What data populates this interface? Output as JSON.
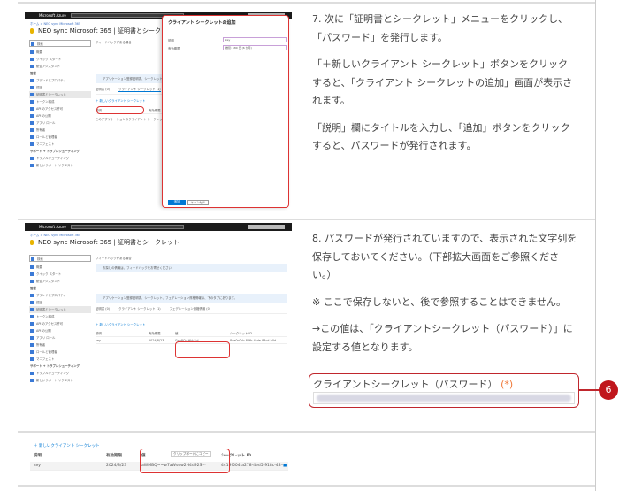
{
  "step7": {
    "paragraphs": [
      "7. 次に「証明書とシークレット」メニューをクリックし、「パスワード」を発行します。",
      "「＋新しいクライアント シークレット」ボタンをクリックすると、「クライアント シークレットの追加」画面が表示されます。",
      "「説明」欄にタイトルを入力し、「追加」ボタンをクリックすると、パスワードが発行されます。"
    ]
  },
  "step8": {
    "paragraphs": [
      "8. パスワードが発行されていますので、表示された文字列を保存しておいてください。（下部拡大画面をご参照ください。）",
      "※ ここで保存しないと、後で参照することはできません。",
      "→この値は、「クライアントシークレット（パスワード）」に設定する値となります。"
    ],
    "field_label": "クライアントシークレット（パスワード）",
    "required_mark": "(*)",
    "badge": "6"
  },
  "azure": {
    "brand": "Microsoft Azure",
    "search": "リソース、サービス、ドキュメントの検索 (G+/)",
    "breadcrumb": "ホーム > NEO sync Microsoft 365",
    "title": "NEO sync Microsoft 365 | 証明書とシークレット",
    "sidebar": [
      {
        "label": "検索",
        "type": "search"
      },
      {
        "label": "概要"
      },
      {
        "label": "クイック スタート"
      },
      {
        "label": "統合アシスタント"
      },
      {
        "label": "管理",
        "type": "header"
      },
      {
        "label": "ブランドとプロパティ"
      },
      {
        "label": "認証"
      },
      {
        "label": "証明書とシークレット",
        "selected": true
      },
      {
        "label": "トークン構成"
      },
      {
        "label": "API のアクセス許可"
      },
      {
        "label": "API の公開"
      },
      {
        "label": "アプリ ロール"
      },
      {
        "label": "所有者"
      },
      {
        "label": "ロールと管理者"
      },
      {
        "label": "マニフェスト"
      },
      {
        "label": "サポート + トラブルシューティング",
        "type": "header"
      },
      {
        "label": "トラブルシューティング"
      },
      {
        "label": "新しいサポート リクエスト"
      }
    ],
    "feedback": "フィードバックがある場合",
    "info1": "お探しの情報は、フィードバックをお寄せください。",
    "info2": "アプリケーション登録証明書、シークレット、フェデレーション資格情報は、下のタブにあります。",
    "tabs": [
      "証明書 (0)",
      "クライアント シークレット (1)",
      "フェデレーション資格情報 (0)"
    ],
    "new_secret": "＋ 新しいクライアント シークレット",
    "columns": [
      "説明",
      "有効期限",
      "値",
      "シークレット ID"
    ],
    "empty_row": "このアプリケーションのクライアント シークレットは作成されていません。",
    "row": {
      "desc": "key",
      "expires": "2024/8/23",
      "value": "Gpu8Q~HVu7yJ...",
      "secret_id": "8ae0c0cb-86fb-4cde-84cd-b0d..."
    },
    "row_zoom": {
      "desc": "key",
      "expires": "2024/8/23",
      "value": "aWMBQ~~w7aWsew2H4d92S···",
      "secret_id": "4419f504-a278-4ed5-918c-48···",
      "tooltip": "クリップボードにコピー"
    },
    "panel": {
      "title": "クライアント シークレットの追加",
      "desc_label": "説明",
      "desc_value": "key",
      "expiry_label": "有効期限",
      "expiry_value": "推奨: 180 日 (6 か月)",
      "add": "追加",
      "cancel": "キャンセル"
    }
  },
  "colors": {
    "highlight": "#d33333",
    "badge": "#c0161c",
    "required": "#f07a3a",
    "azure_blue": "#0078d4"
  }
}
